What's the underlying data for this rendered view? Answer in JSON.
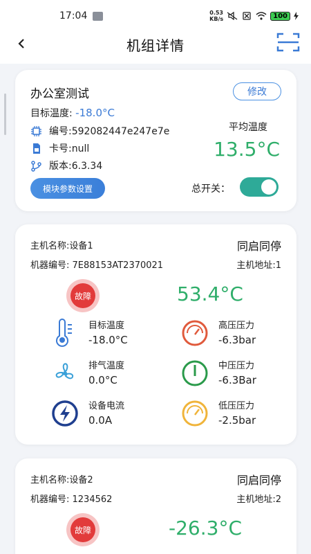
{
  "status_bar": {
    "time": "17:04",
    "speed_value": "0.53",
    "speed_unit": "KB/s",
    "battery": "100"
  },
  "header": {
    "title": "机组详情"
  },
  "unit": {
    "name": "办公室测试",
    "edit_label": "修改",
    "target_label": "目标温度: ",
    "target_value": "-18.0°C",
    "serial": "编号:592082447e247e7e",
    "card": "卡号:null",
    "version": "版本:6.3.34",
    "module_button": "模块参数设置",
    "avg_label": "平均温度",
    "avg_value": "13.5°C",
    "switch_label": "总开关：",
    "switch_on": true
  },
  "devices": [
    {
      "name": "主机名称:设备1",
      "mode": "同启同停",
      "code": "机器编号: 7E88153AT2370021",
      "address": "主机地址:1",
      "status": "故障",
      "temp": "53.4°C",
      "metrics": [
        {
          "label": "目标温度",
          "value": "-18.0°C",
          "icon": "thermometer-icon",
          "color": "#3a7ad5"
        },
        {
          "label": "高压压力",
          "value": "-6.3bar",
          "icon": "gauge-icon",
          "color": "#e05a3c"
        },
        {
          "label": "排气温度",
          "value": "0.0°C",
          "icon": "fan-icon",
          "color": "#3aa0d8"
        },
        {
          "label": "中压压力",
          "value": "-6.3Bar",
          "icon": "gauge-icon",
          "color": "#2a9a4a"
        },
        {
          "label": "设备电流",
          "value": "0.0A",
          "icon": "current-icon",
          "color": "#1f3f8f"
        },
        {
          "label": "低压压力",
          "value": "-2.5bar",
          "icon": "gauge-icon",
          "color": "#f0b43a"
        }
      ]
    },
    {
      "name": "主机名称:设备2",
      "mode": "同启同停",
      "code": "机器编号: 1234562",
      "address": "主机地址:2",
      "status": "故障",
      "temp": "-26.3°C"
    }
  ]
}
